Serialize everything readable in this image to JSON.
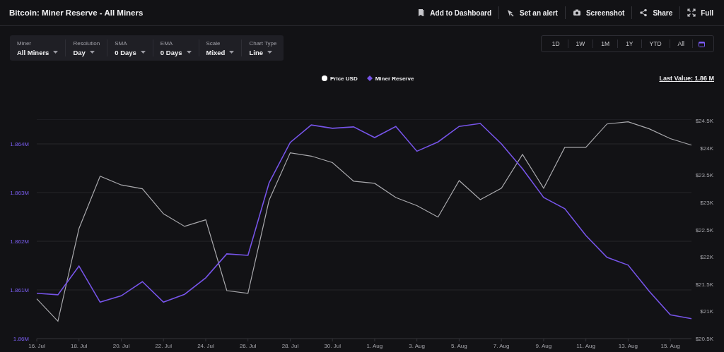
{
  "header": {
    "title": "Bitcoin: Miner Reserve - All Miners",
    "actions": [
      {
        "kind": "dashboard",
        "label": "Add to Dashboard"
      },
      {
        "kind": "alert",
        "label": "Set an alert"
      },
      {
        "kind": "screenshot",
        "label": "Screenshot"
      },
      {
        "kind": "share",
        "label": "Share"
      },
      {
        "kind": "full",
        "label": "Full"
      }
    ]
  },
  "filters": [
    {
      "label": "Miner",
      "value": "All Miners"
    },
    {
      "label": "Resolution",
      "value": "Day"
    },
    {
      "label": "SMA",
      "value": "0 Days"
    },
    {
      "label": "EMA",
      "value": "0 Days"
    },
    {
      "label": "Scale",
      "value": "Mixed"
    },
    {
      "label": "Chart Type",
      "value": "Line"
    }
  ],
  "ranges": [
    {
      "label": "1D",
      "selected": false
    },
    {
      "label": "1W",
      "selected": false
    },
    {
      "label": "1M",
      "selected": false
    },
    {
      "label": "1Y",
      "selected": false
    },
    {
      "label": "YTD",
      "selected": false
    },
    {
      "label": "All",
      "selected": false
    }
  ],
  "last_value": "Last Value: 1.86 M",
  "chart_data": {
    "type": "line",
    "categories": [
      "16. Jul",
      null,
      "18. Jul",
      null,
      "20. Jul",
      null,
      "22. Jul",
      null,
      "24. Jul",
      null,
      "26. Jul",
      null,
      "28. Jul",
      null,
      "30. Jul",
      null,
      "1. Aug",
      null,
      "3. Aug",
      null,
      "5. Aug",
      null,
      "7. Aug",
      null,
      "9. Aug",
      null,
      "11. Aug",
      null,
      "13. Aug",
      null,
      "15. Aug",
      null
    ],
    "grid": true,
    "ylim": [
      1860000,
      1864500
    ],
    "y2lim": [
      20500,
      24520
    ],
    "yticks": [
      {
        "value": 1860000,
        "label": "1.86M"
      },
      {
        "value": 1861000,
        "label": "1.861M"
      },
      {
        "value": 1862000,
        "label": "1.862M"
      },
      {
        "value": 1863000,
        "label": "1.863M"
      },
      {
        "value": 1864000,
        "label": "1.864M"
      }
    ],
    "y2ticks": [
      {
        "value": 20500,
        "label": "$20.5K"
      },
      {
        "value": 21000,
        "label": "$21K"
      },
      {
        "value": 21500,
        "label": "$21.5K"
      },
      {
        "value": 22000,
        "label": "$22K"
      },
      {
        "value": 22500,
        "label": "$22.5K"
      },
      {
        "value": 23000,
        "label": "$23K"
      },
      {
        "value": 23500,
        "label": "$23.5K"
      },
      {
        "value": 24000,
        "label": "$24K"
      },
      {
        "value": 24500,
        "label": "$24.5K"
      }
    ],
    "series": [
      {
        "name": "Price USD",
        "color": "#a9a9ad",
        "axis": "y2",
        "values": [
          21230,
          20820,
          22520,
          23480,
          23320,
          23250,
          22790,
          22560,
          22680,
          21380,
          21330,
          23040,
          23910,
          23850,
          23730,
          23390,
          23350,
          23090,
          22940,
          22730,
          23400,
          23050,
          23260,
          23880,
          23260,
          24010,
          24010,
          24440,
          24480,
          24350,
          24170,
          24050
        ]
      },
      {
        "name": "Miner Reserve",
        "color": "#7654e8",
        "values": [
          1860930,
          1860900,
          1861490,
          1860750,
          1860880,
          1861170,
          1860750,
          1860910,
          1861250,
          1861740,
          1861710,
          1863200,
          1864030,
          1864390,
          1864320,
          1864350,
          1864130,
          1864360,
          1863850,
          1864040,
          1864360,
          1864420,
          1864000,
          1863490,
          1862900,
          1862670,
          1862120,
          1861670,
          1861510,
          1860970,
          1860490,
          1860410
        ]
      }
    ]
  }
}
